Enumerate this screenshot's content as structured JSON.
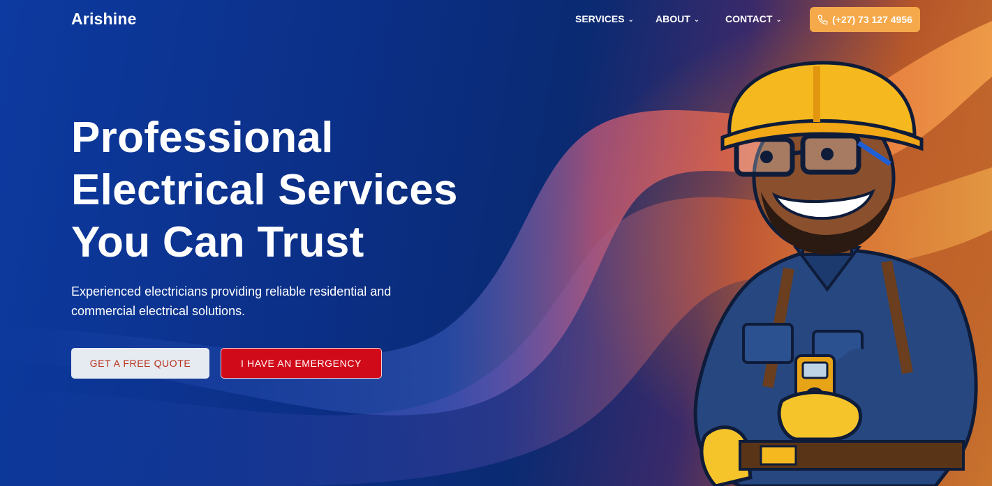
{
  "brand": {
    "name": "Arishine"
  },
  "nav": {
    "items": [
      {
        "label": "SERVICES"
      },
      {
        "label": "ABOUT"
      },
      {
        "label": "CONTACT"
      }
    ],
    "phone": "(+27) 73 127 4956"
  },
  "hero": {
    "headline": [
      "Professional",
      "Electrical Services",
      "You Can Trust"
    ],
    "subtext": "Experienced electricians providing reliable residential and commercial electrical solutions.",
    "cta_quote": "GET A FREE QUOTE",
    "cta_emergency": "I HAVE AN EMERGENCY"
  },
  "icons": {
    "nav_dropdown": "chevron-down-icon",
    "phone": "phone-icon"
  },
  "colors": {
    "accent_orange": "#f5a94a",
    "emergency_red": "#d10a1a",
    "quote_text": "#b8321a",
    "hero_blue": "#0b2f86"
  }
}
